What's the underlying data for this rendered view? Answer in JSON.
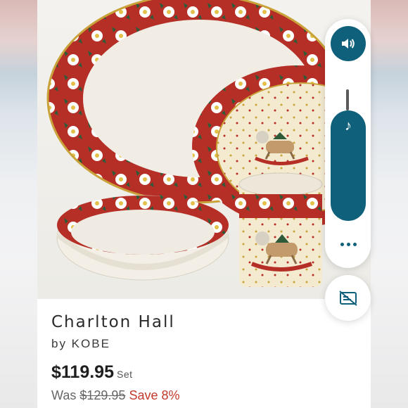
{
  "product": {
    "title": "Charlton Hall",
    "brand": "by KOBE",
    "price": "$119.95",
    "unit": "Set",
    "was_label": "Was",
    "was_price": "$129.95",
    "savings": "Save 8%"
  },
  "overlay": {
    "volume_icon": "speaker-icon",
    "music_icon": "music-note-icon",
    "more_icon": "more-dots-icon",
    "captions_icon": "captions-off-icon",
    "volume_level": 0.55
  },
  "colors": {
    "accent": "#0f607b",
    "save": "#c0392b",
    "china_red": "#b62f27",
    "china_green": "#2f5a3a"
  }
}
